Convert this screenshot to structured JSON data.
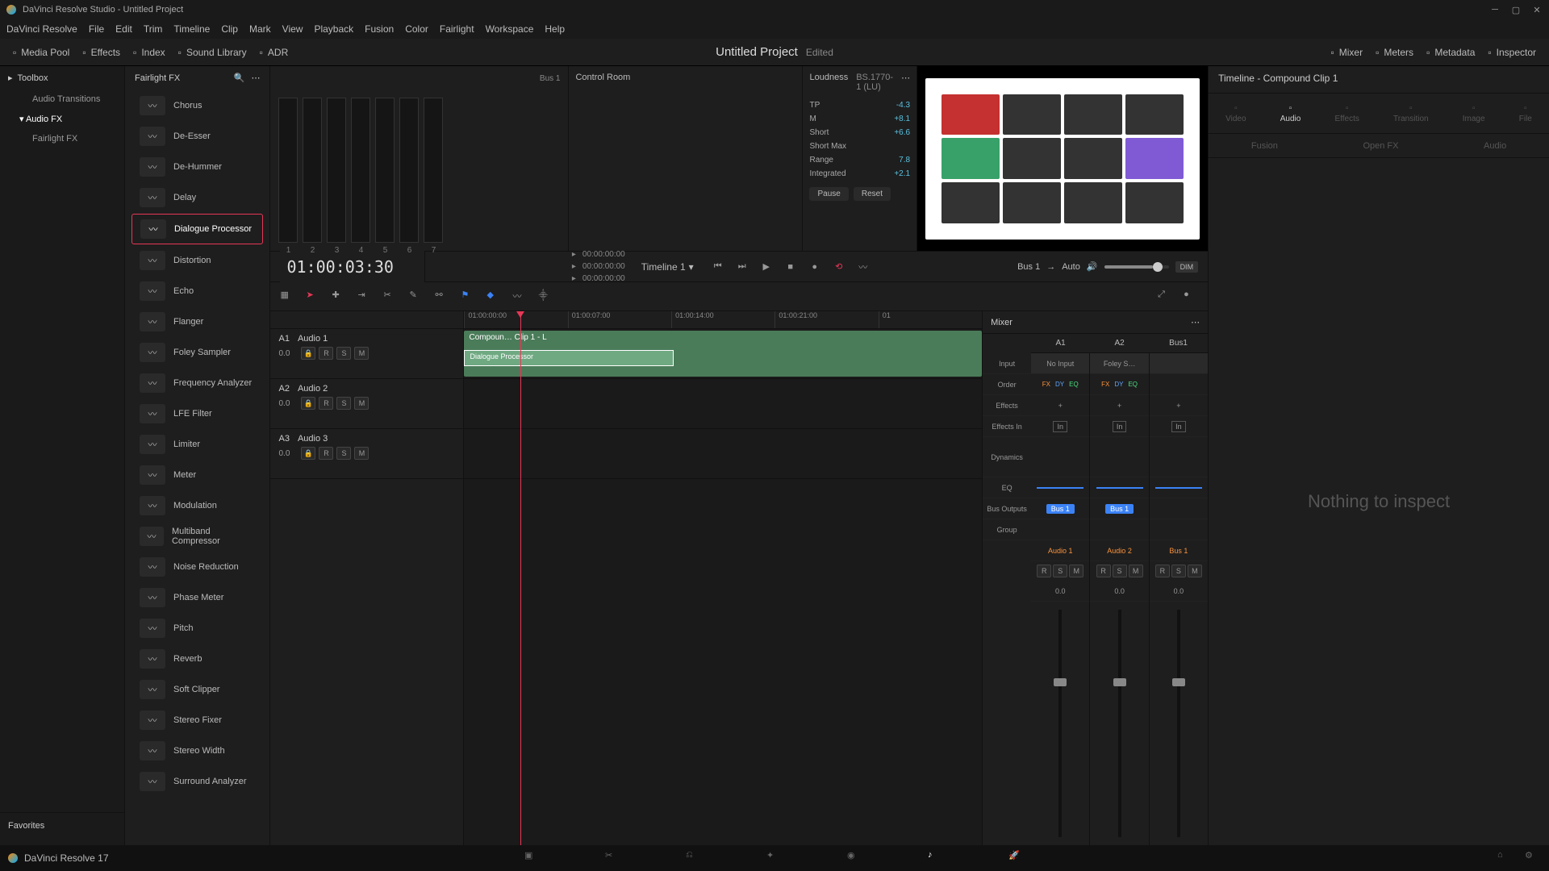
{
  "titlebar": {
    "app": "DaVinci Resolve Studio",
    "project": "Untitled Project"
  },
  "menu": [
    "DaVinci Resolve",
    "File",
    "Edit",
    "Trim",
    "Timeline",
    "Clip",
    "Mark",
    "View",
    "Playback",
    "Fusion",
    "Color",
    "Fairlight",
    "Workspace",
    "Help"
  ],
  "toolbar": {
    "left": [
      {
        "id": "media-pool",
        "label": "Media Pool"
      },
      {
        "id": "effects",
        "label": "Effects"
      },
      {
        "id": "index",
        "label": "Index"
      },
      {
        "id": "sound-library",
        "label": "Sound Library"
      },
      {
        "id": "adr",
        "label": "ADR"
      }
    ],
    "right": [
      {
        "id": "mixer",
        "label": "Mixer"
      },
      {
        "id": "meters",
        "label": "Meters"
      },
      {
        "id": "metadata",
        "label": "Metadata"
      },
      {
        "id": "inspector",
        "label": "Inspector"
      }
    ],
    "project": "Untitled Project",
    "status": "Edited"
  },
  "toolbox": {
    "title": "Toolbox",
    "items": [
      {
        "label": "Audio Transitions",
        "sub": true
      },
      {
        "label": "Audio FX",
        "sub": false,
        "active": true
      },
      {
        "label": "Fairlight FX",
        "sub": true
      }
    ]
  },
  "fxHeader": "Fairlight FX",
  "fxItems": [
    "Chorus",
    "De-Esser",
    "De-Hummer",
    "Delay",
    "Dialogue Processor",
    "Distortion",
    "Echo",
    "Flanger",
    "Foley Sampler",
    "Frequency Analyzer",
    "LFE Filter",
    "Limiter",
    "Meter",
    "Modulation",
    "Multiband Compressor",
    "Noise Reduction",
    "Phase Meter",
    "Pitch",
    "Reverb",
    "Soft Clipper",
    "Stereo Fixer",
    "Stereo Width",
    "Surround Analyzer"
  ],
  "fxSelected": "Dialogue Processor",
  "favorites": "Favorites",
  "controlRoom": {
    "title": "Control Room",
    "bus": "Bus 1"
  },
  "loudness": {
    "title": "Loudness",
    "standard": "BS.1770-1 (LU)",
    "rows": [
      {
        "l": "TP",
        "v": "-4.3"
      },
      {
        "l": "M",
        "v": "+8.1"
      },
      {
        "l": "Short",
        "v": "+6.6"
      },
      {
        "l": "Short Max",
        "v": ""
      },
      {
        "l": "Range",
        "v": "7.8"
      },
      {
        "l": "Integrated",
        "v": "+2.1"
      }
    ],
    "pause": "Pause",
    "reset": "Reset"
  },
  "transport": {
    "timecode": "01:00:03:30",
    "timeline": "Timeline 1",
    "bus": "Bus 1",
    "auto": "Auto",
    "dim": "DIM",
    "markers": [
      "00:00:00:00",
      "00:00:00:00",
      "00:00:00:00"
    ]
  },
  "ruler": [
    "01:00:00:00",
    "01:00:07:00",
    "01:00:14:00",
    "01:00:21:00",
    "01"
  ],
  "tracks": [
    {
      "id": "A1",
      "name": "Audio 1",
      "val": "0.0"
    },
    {
      "id": "A2",
      "name": "Audio 2",
      "val": "0.0"
    },
    {
      "id": "A3",
      "name": "Audio 3",
      "val": "0.0"
    }
  ],
  "clip": {
    "title": "Compoun…  Clip 1 - L",
    "fx": "Dialogue Processor"
  },
  "inspector": {
    "title": "Timeline - Compound Clip 1",
    "tabs": [
      "Video",
      "Audio",
      "Effects",
      "Transition",
      "Image",
      "File"
    ],
    "subtabs": [
      "Fusion",
      "Open FX",
      "Audio"
    ],
    "empty": "Nothing to inspect"
  },
  "mixer": {
    "title": "Mixer",
    "channels": [
      "A1",
      "A2",
      "Bus1"
    ],
    "rows": {
      "input": "Input",
      "order": "Order",
      "effects": "Effects",
      "effectsIn": "Effects In",
      "dynamics": "Dynamics",
      "eq": "EQ",
      "busOutputs": "Bus Outputs",
      "group": "Group"
    },
    "inputs": [
      "No Input",
      "Foley S…",
      ""
    ],
    "busOut": "Bus 1",
    "names": [
      "Audio 1",
      "Audio 2",
      "Bus 1"
    ],
    "vals": [
      "0.0",
      "0.0",
      "0.0"
    ],
    "in": "In",
    "plus": "+",
    "rsm": [
      "R",
      "S",
      "M"
    ]
  },
  "bottom": {
    "app": "DaVinci Resolve 17"
  }
}
